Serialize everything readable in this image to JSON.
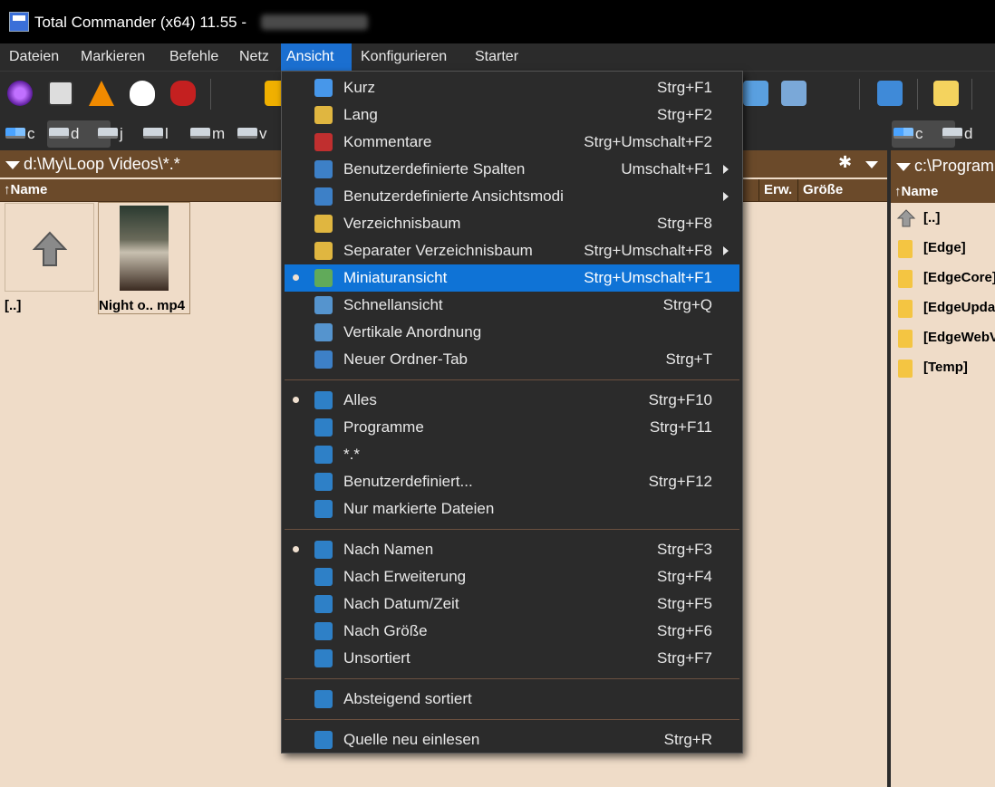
{
  "window": {
    "title": "Total Commander (x64) 11.55 -"
  },
  "menubar": [
    "Dateien",
    "Markieren",
    "Befehle",
    "Netz",
    "Ansicht",
    "Konfigurieren",
    "Starter"
  ],
  "drives_left": [
    {
      "letter": "c"
    },
    {
      "letter": "d"
    },
    {
      "letter": "j"
    },
    {
      "letter": "l"
    },
    {
      "letter": "m"
    },
    {
      "letter": "v"
    }
  ],
  "drives_right": [
    {
      "letter": "c"
    },
    {
      "letter": "d"
    }
  ],
  "left_panel": {
    "path": "d:\\My\\Loop Videos\\*.*",
    "columns": {
      "name": "Name",
      "ext": "Erw.",
      "size": "Größe"
    },
    "items": [
      {
        "label": "[..]"
      },
      {
        "label": "Night o.. mp4"
      }
    ]
  },
  "right_panel": {
    "path": "c:\\Program",
    "column_name": "Name",
    "items": [
      "[..]",
      "[Edge]",
      "[EdgeCore]",
      "[EdgeUpda",
      "[EdgeWebV",
      "[Temp]"
    ]
  },
  "menu_ansicht": {
    "groups": [
      [
        {
          "label": "Kurz",
          "shortcut": "Strg+F1"
        },
        {
          "label": "Lang",
          "shortcut": "Strg+F2"
        },
        {
          "label": "Kommentare",
          "shortcut": "Strg+Umschalt+F2"
        },
        {
          "label": "Benutzerdefinierte Spalten",
          "shortcut": "Umschalt+F1",
          "submenu": true
        },
        {
          "label": "Benutzerdefinierte Ansichtsmodi",
          "shortcut": "",
          "submenu": true
        },
        {
          "label": "Verzeichnisbaum",
          "shortcut": "Strg+F8"
        },
        {
          "label": "Separater Verzeichnisbaum",
          "shortcut": "Strg+Umschalt+F8",
          "submenu": true
        },
        {
          "label": "Miniaturansicht",
          "shortcut": "Strg+Umschalt+F1",
          "checked": true,
          "selected": true
        },
        {
          "label": "Schnellansicht",
          "shortcut": "Strg+Q"
        },
        {
          "label": "Vertikale Anordnung",
          "shortcut": ""
        },
        {
          "label": "Neuer Ordner-Tab",
          "shortcut": "Strg+T"
        }
      ],
      [
        {
          "label": "Alles",
          "shortcut": "Strg+F10",
          "checked": true
        },
        {
          "label": "Programme",
          "shortcut": "Strg+F11"
        },
        {
          "label": "*.*",
          "shortcut": ""
        },
        {
          "label": "Benutzerdefiniert...",
          "shortcut": "Strg+F12"
        },
        {
          "label": "Nur markierte Dateien",
          "shortcut": ""
        }
      ],
      [
        {
          "label": "Nach Namen",
          "shortcut": "Strg+F3",
          "checked": true
        },
        {
          "label": "Nach Erweiterung",
          "shortcut": "Strg+F4"
        },
        {
          "label": "Nach Datum/Zeit",
          "shortcut": "Strg+F5"
        },
        {
          "label": "Nach Größe",
          "shortcut": "Strg+F6"
        },
        {
          "label": "Unsortiert",
          "shortcut": "Strg+F7"
        }
      ],
      [
        {
          "label": "Absteigend sortiert",
          "shortcut": ""
        }
      ],
      [
        {
          "label": "Quelle neu einlesen",
          "shortcut": "Strg+R"
        }
      ]
    ]
  },
  "colors": {
    "accent": "#0f73d6",
    "panel_bg": "#efdcc8",
    "panel_header": "#6b4a2a"
  }
}
